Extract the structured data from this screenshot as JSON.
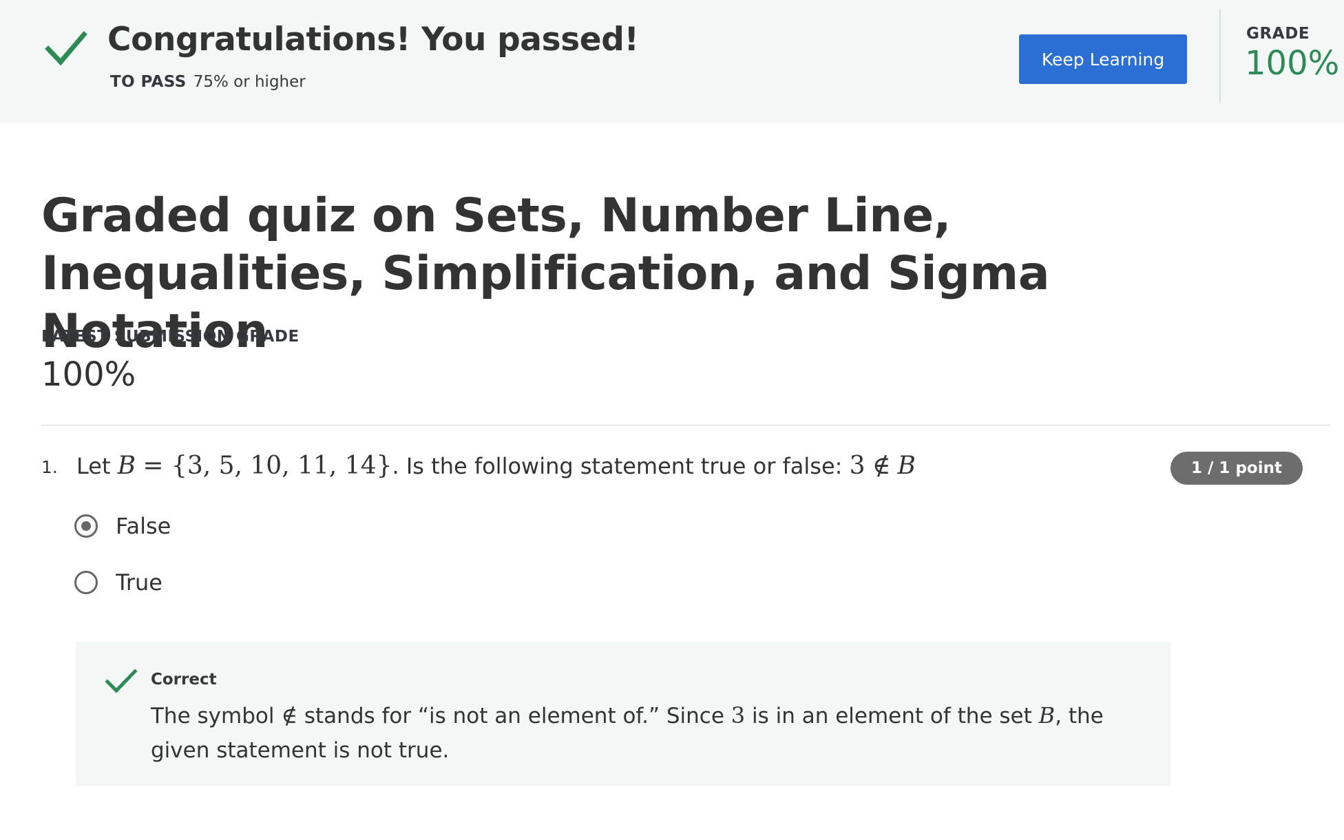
{
  "banner": {
    "title": "Congratulations! You passed!",
    "to_pass_label": "TO PASS",
    "to_pass_value": "75% or higher",
    "button_label": "Keep Learning",
    "grade_label": "GRADE",
    "grade_value": "100%"
  },
  "quiz": {
    "title": "Graded quiz on Sets, Number Line, Inequalities, Simplification, and Sigma Notation",
    "latest_label": "LATEST SUBMISSION GRADE",
    "latest_value": "100%"
  },
  "question": {
    "number": "1.",
    "prefix": "Let",
    "set_var": "B",
    "set_eq": "= {3, 5, 10, 11, 14}",
    "middle": ". Is the following statement true or false:",
    "stmt_num": "3",
    "stmt_sym": "∉",
    "stmt_var": "B",
    "points": "1 / 1 point",
    "options": [
      {
        "label": "False",
        "selected": true
      },
      {
        "label": "True",
        "selected": false
      }
    ]
  },
  "feedback": {
    "title": "Correct",
    "t1": "The symbol",
    "sym": "∉",
    "t2": "stands for “is not an element of.” Since",
    "num": "3",
    "t3": "is in an element of the set",
    "var": "B",
    "t4": ", the given statement is not true."
  },
  "colors": {
    "success_green": "#2e8a55",
    "banner_bg": "#f3f8f6",
    "button_blue": "#2b6fd4",
    "badge_gray": "#6d6d6d"
  },
  "icons": {
    "banner": "check-icon",
    "feedback": "check-icon"
  }
}
